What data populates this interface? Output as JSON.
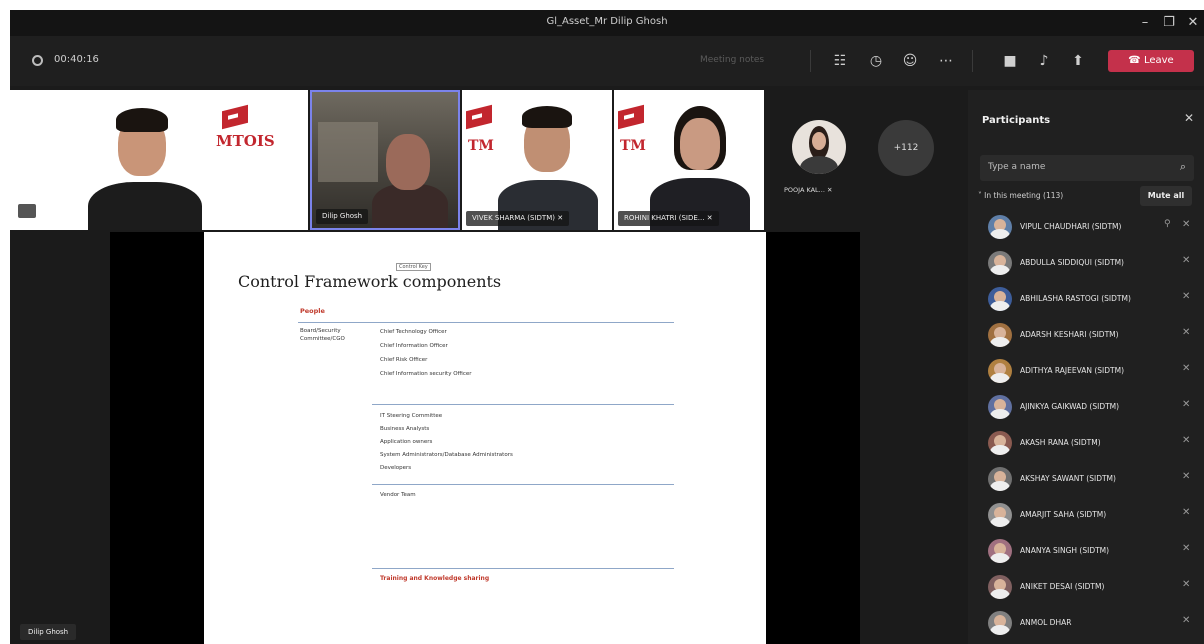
{
  "window": {
    "title": "Gl_Asset_Mr Dilip Ghosh",
    "minimize": "–",
    "maximize": "❐",
    "close": "✕"
  },
  "toolbar": {
    "timer": "00:40:16",
    "meeting_notes": "Meeting notes",
    "leave_label": "Leave"
  },
  "tiles": [
    {
      "name": "",
      "logo": "MTOIS"
    },
    {
      "name": "Dilip Ghosh"
    },
    {
      "name": "VIVEK SHARMA (SIDTM)",
      "logo": "TM"
    },
    {
      "name": "ROHINI KHATRI (SIDE...",
      "logo": "TM"
    },
    {
      "name": "POOJA KAL..."
    }
  ],
  "overflow": {
    "count": "+112"
  },
  "participants": {
    "title": "Participants",
    "close": "✕",
    "search_placeholder": "Type a name",
    "in_meeting": "In this meeting (113)",
    "mute_all": "Mute all",
    "list": [
      {
        "name": "VIPUL CHAUDHARI (SIDTM)",
        "color": "#5f7fa8"
      },
      {
        "name": "ABDULLA SIDDIQUI (SIDTM)",
        "color": "#7a7a7a"
      },
      {
        "name": "ABHILASHA RASTOGI (SIDTM)",
        "color": "#3d5d9a"
      },
      {
        "name": "ADARSH KESHARI (SIDTM)",
        "color": "#a07040"
      },
      {
        "name": "ADITHYA RAJEEVAN (SIDTM)",
        "color": "#b08040"
      },
      {
        "name": "AJINKYA GAIKWAD (SIDTM)",
        "color": "#6070a0"
      },
      {
        "name": "AKASH RANA (SIDTM)",
        "color": "#8a5a50"
      },
      {
        "name": "AKSHAY SAWANT (SIDTM)",
        "color": "#707070"
      },
      {
        "name": "AMARJIT SAHA (SIDTM)",
        "color": "#909090"
      },
      {
        "name": "ANANYA SINGH (SIDTM)",
        "color": "#a07080"
      },
      {
        "name": "ANIKET DESAI (SIDTM)",
        "color": "#806060"
      },
      {
        "name": "ANMOL DHAR",
        "color": "#808080"
      }
    ]
  },
  "slide": {
    "title": "Control Framework components",
    "tag": "Control Key",
    "people_heading": "People",
    "group1_label": [
      "Board/Security",
      "Committee/CGO"
    ],
    "group1_items": [
      "Chief Technology Officer",
      "Chief Information Officer",
      "Chief Risk Officer",
      "Chief Information security Officer"
    ],
    "group2_items": [
      "IT Steering Committee",
      "Business Analysts",
      "Application owners",
      "System Administrators/Database Administrators",
      "Developers"
    ],
    "group3_items": [
      "Vendor Team"
    ],
    "training": "Training and Knowledge sharing"
  },
  "presenter": "Dilip Ghosh"
}
